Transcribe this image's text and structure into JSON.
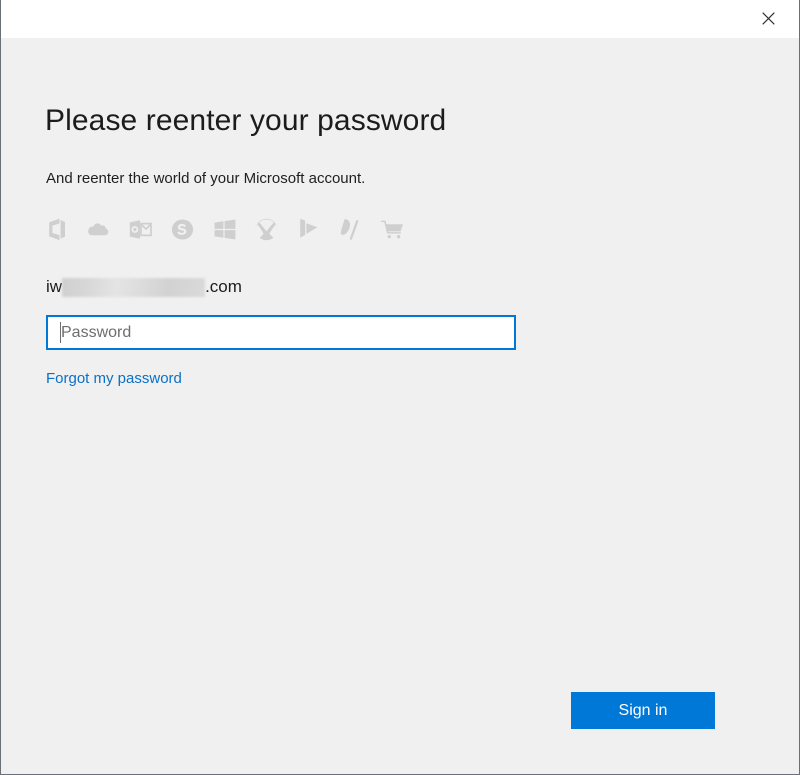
{
  "window": {
    "titlebar": {
      "close_icon": "close-icon"
    }
  },
  "main": {
    "headline": "Please reenter your password",
    "subheadline": "And reenter the world of your Microsoft account.",
    "service_icons": [
      {
        "name": "office-icon",
        "label": "Office"
      },
      {
        "name": "onedrive-icon",
        "label": "OneDrive"
      },
      {
        "name": "outlook-icon",
        "label": "Outlook"
      },
      {
        "name": "skype-icon",
        "label": "Skype"
      },
      {
        "name": "windows-icon",
        "label": "Windows"
      },
      {
        "name": "xbox-icon",
        "label": "Xbox"
      },
      {
        "name": "bing-icon",
        "label": "Bing"
      },
      {
        "name": "groove-music-icon",
        "label": "Groove Music"
      },
      {
        "name": "store-icon",
        "label": "Store"
      }
    ],
    "account": {
      "prefix": "iw",
      "redacted": true,
      "suffix": ".com"
    },
    "password": {
      "value": "",
      "placeholder": "Password"
    },
    "forgot_link": "Forgot my password",
    "signin_button": "Sign in"
  },
  "colors": {
    "accent": "#0078d7",
    "link": "#0a71c8",
    "body_background": "#f0f0f0",
    "titlebar_background": "#ffffff",
    "icon_grey": "#cfcfcf",
    "window_border": "#6b7078"
  }
}
